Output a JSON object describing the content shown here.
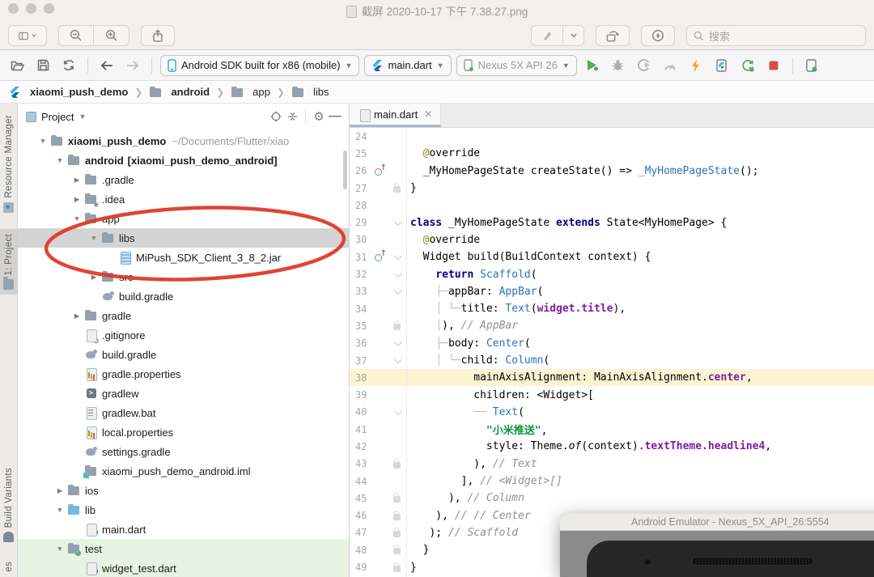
{
  "preview": {
    "title": "截屏 2020-10-17 下午 7.38.27.png",
    "search_placeholder": "搜索"
  },
  "ide": {
    "toolbar": {
      "device_selector": "Android SDK built for x86 (mobile)",
      "run_config": "main.dart",
      "target_device": "Nexus 5X API 26"
    },
    "breadcrumb": [
      {
        "label": "xiaomi_push_demo",
        "icon": "flutter",
        "bold": true
      },
      {
        "label": "android",
        "icon": "folder",
        "bold": true
      },
      {
        "label": "app",
        "icon": "folder",
        "bold": false
      },
      {
        "label": "libs",
        "icon": "folder",
        "bold": false
      }
    ],
    "strip": {
      "top": [
        {
          "label": "Resource Manager",
          "icon": "resource",
          "active": false
        },
        {
          "label": "1: Project",
          "icon": "project",
          "active": true
        }
      ],
      "bottom": [
        {
          "label": "Build Variants",
          "icon": "android",
          "active": false
        },
        {
          "label": "es",
          "icon": "",
          "active": false
        }
      ]
    },
    "project": {
      "title": "Project",
      "tree": [
        {
          "i": 0,
          "a": "d",
          "ic": "folder",
          "label": "xiaomi_push_demo",
          "bold": true,
          "note": "~/Documents/Flutter/xiao"
        },
        {
          "i": 1,
          "a": "d",
          "ic": "folder",
          "label": "android",
          "bold": true,
          "tag": "[xiaomi_push_demo_android]"
        },
        {
          "i": 2,
          "a": "r",
          "ic": "folder",
          "label": ".gradle"
        },
        {
          "i": 2,
          "a": "r",
          "ic": "folder-idea",
          "label": ".idea"
        },
        {
          "i": 2,
          "a": "d",
          "ic": "folder",
          "label": "app"
        },
        {
          "i": 3,
          "a": "d",
          "ic": "folder",
          "label": "libs",
          "sel": true
        },
        {
          "i": 4,
          "a": "",
          "ic": "jar",
          "label": "MiPush_SDK_Client_3_8_2.jar"
        },
        {
          "i": 3,
          "a": "r",
          "ic": "folder",
          "label": "src"
        },
        {
          "i": 3,
          "a": "",
          "ic": "gradle",
          "label": "build.gradle"
        },
        {
          "i": 2,
          "a": "r",
          "ic": "folder",
          "label": "gradle"
        },
        {
          "i": 2,
          "a": "",
          "ic": "ignore",
          "label": ".gitignore"
        },
        {
          "i": 2,
          "a": "",
          "ic": "gradle",
          "label": "build.gradle"
        },
        {
          "i": 2,
          "a": "",
          "ic": "props",
          "label": "gradle.properties"
        },
        {
          "i": 2,
          "a": "",
          "ic": "console",
          "label": "gradlew"
        },
        {
          "i": 2,
          "a": "",
          "ic": "textfile",
          "label": "gradlew.bat"
        },
        {
          "i": 2,
          "a": "",
          "ic": "props",
          "label": "local.properties"
        },
        {
          "i": 2,
          "a": "",
          "ic": "gradle",
          "label": "settings.gradle"
        },
        {
          "i": 2,
          "a": "",
          "ic": "module",
          "label": "xiaomi_push_demo_android.iml"
        },
        {
          "i": 1,
          "a": "r",
          "ic": "folder-dots",
          "label": "ios"
        },
        {
          "i": 1,
          "a": "d",
          "ic": "folder-blue",
          "label": "lib"
        },
        {
          "i": 2,
          "a": "",
          "ic": "dart",
          "label": "main.dart"
        },
        {
          "i": 1,
          "a": "d",
          "ic": "folder-test",
          "label": "test",
          "green": true
        },
        {
          "i": 2,
          "a": "",
          "ic": "dart",
          "label": "widget_test.dart",
          "green": true
        }
      ]
    },
    "editor": {
      "tab": "main.dart",
      "lines": [
        {
          "n": 24,
          "seg": []
        },
        {
          "n": 25,
          "seg": [
            [
              "d",
              "  "
            ],
            [
              "a",
              "@"
            ],
            [
              "d",
              "override"
            ]
          ]
        },
        {
          "n": 26,
          "m": "ovr",
          "seg": [
            [
              "d",
              "  _MyHomePageState createState() => "
            ],
            [
              "c",
              "_MyHomePageState"
            ],
            [
              "d",
              "();"
            ]
          ]
        },
        {
          "n": 27,
          "g": "lock",
          "seg": [
            [
              "d",
              "}"
            ]
          ]
        },
        {
          "n": 28,
          "seg": []
        },
        {
          "n": 29,
          "g": "fold",
          "seg": [
            [
              "k",
              "class"
            ],
            [
              "d",
              " _MyHomePageState "
            ],
            [
              "k",
              "extends"
            ],
            [
              "d",
              " State<MyHomePage> {"
            ]
          ]
        },
        {
          "n": 30,
          "seg": [
            [
              "d",
              "  "
            ],
            [
              "a",
              "@"
            ],
            [
              "d",
              "override"
            ]
          ]
        },
        {
          "n": 31,
          "m": "ovr",
          "g": "fold",
          "seg": [
            [
              "d",
              "  Widget build(BuildContext context) {"
            ]
          ]
        },
        {
          "n": 32,
          "g": "fold",
          "seg": [
            [
              "d",
              "    "
            ],
            [
              "k",
              "return"
            ],
            [
              "d",
              " "
            ],
            [
              "c",
              "Scaffold"
            ],
            [
              "d",
              "("
            ]
          ]
        },
        {
          "n": 33,
          "g": "fold",
          "seg": [
            [
              "d",
              "    "
            ],
            [
              "g",
              "├─"
            ],
            [
              "d",
              "appBar: "
            ],
            [
              "c",
              "AppBar"
            ],
            [
              "d",
              "("
            ]
          ]
        },
        {
          "n": 34,
          "seg": [
            [
              "d",
              "    "
            ],
            [
              "g",
              "│ └─"
            ],
            [
              "d",
              "title: "
            ],
            [
              "c",
              "Text"
            ],
            [
              "d",
              "("
            ],
            [
              "p",
              "widget.title"
            ],
            [
              "d",
              "),"
            ]
          ]
        },
        {
          "n": 35,
          "g": "lock",
          "seg": [
            [
              "d",
              "    "
            ],
            [
              "g",
              "│"
            ],
            [
              "d",
              "), "
            ],
            [
              "m",
              "// AppBar"
            ]
          ]
        },
        {
          "n": 36,
          "g": "fold",
          "seg": [
            [
              "d",
              "    "
            ],
            [
              "g",
              "├─"
            ],
            [
              "d",
              "body: "
            ],
            [
              "c",
              "Center"
            ],
            [
              "d",
              "("
            ]
          ]
        },
        {
          "n": 37,
          "g": "fold",
          "seg": [
            [
              "d",
              "    "
            ],
            [
              "g",
              "│ └─"
            ],
            [
              "d",
              "child: "
            ],
            [
              "c",
              "Column"
            ],
            [
              "d",
              "("
            ]
          ]
        },
        {
          "n": 38,
          "hl": true,
          "seg": [
            [
              "d",
              "          mainAxisAlignment: MainAxisAlignment."
            ],
            [
              "p",
              "center"
            ],
            [
              "d",
              ","
            ]
          ]
        },
        {
          "n": 39,
          "seg": [
            [
              "d",
              "          children: <Widget>["
            ]
          ]
        },
        {
          "n": 40,
          "g": "fold",
          "seg": [
            [
              "d",
              "          "
            ],
            [
              "g",
              "── "
            ],
            [
              "c",
              "Text"
            ],
            [
              "d",
              "("
            ]
          ]
        },
        {
          "n": 41,
          "seg": [
            [
              "d",
              "            "
            ],
            [
              "s",
              "\"小米推送\""
            ],
            [
              "d",
              ","
            ]
          ]
        },
        {
          "n": 42,
          "seg": [
            [
              "d",
              "            style: Theme."
            ],
            [
              "i",
              "of"
            ],
            [
              "d",
              "(context)."
            ],
            [
              "p",
              "textTheme.headline4"
            ],
            [
              "d",
              ","
            ]
          ]
        },
        {
          "n": 43,
          "g": "lock",
          "seg": [
            [
              "d",
              "          ), "
            ],
            [
              "m",
              "// Text"
            ]
          ]
        },
        {
          "n": 44,
          "seg": [
            [
              "d",
              "        ], "
            ],
            [
              "m",
              "// <Widget>[]"
            ]
          ]
        },
        {
          "n": 45,
          "g": "lock",
          "seg": [
            [
              "d",
              "      ), "
            ],
            [
              "m",
              "// Column"
            ]
          ]
        },
        {
          "n": 46,
          "g": "lock",
          "seg": [
            [
              "d",
              "    ), "
            ],
            [
              "m",
              "// // Center"
            ]
          ]
        },
        {
          "n": 47,
          "g": "lock",
          "seg": [
            [
              "d",
              "   ); "
            ],
            [
              "m",
              "// Scaffold"
            ]
          ]
        },
        {
          "n": 48,
          "g": "lock",
          "seg": [
            [
              "d",
              "  }"
            ]
          ]
        },
        {
          "n": 49,
          "g": "lock",
          "seg": [
            [
              "d",
              "}"
            ]
          ]
        }
      ]
    }
  },
  "emulator": {
    "title": "Android Emulator - Nexus_5X_API_26:5554"
  }
}
